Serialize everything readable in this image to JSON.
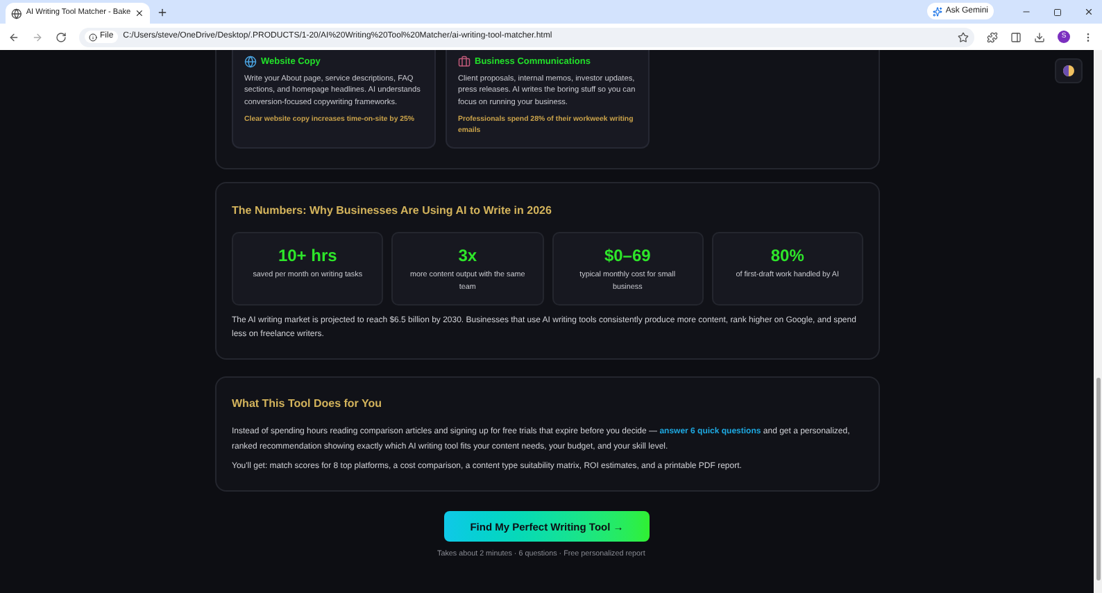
{
  "browser": {
    "tab_title": "AI Writing Tool Matcher - Bake",
    "file_chip": "File",
    "url": "C:/Users/steve/OneDrive/Desktop/.PRODUCTS/1-20/AI%20Writing%20Tool%20Matcher/ai-writing-tool-matcher.html",
    "gemini": "Ask Gemini",
    "avatar": "S"
  },
  "use_cases": [
    {
      "kind": "globe",
      "title": "Website Copy",
      "text": "Write your About page, service descriptions, FAQ sections, and homepage headlines. AI understands conversion-focused copywriting frameworks.",
      "stat": "Clear website copy increases time-on-site by 25%"
    },
    {
      "kind": "briefcase",
      "title": "Business Communications",
      "text": "Client proposals, internal memos, investor updates, press releases. AI writes the boring stuff so you can focus on running your business.",
      "stat": "Professionals spend 28% of their workweek writing emails"
    }
  ],
  "numbers": {
    "title": "The Numbers: Why Businesses Are Using AI to Write in 2026",
    "stats": [
      {
        "value": "10+ hrs",
        "label": "saved per month on writing tasks"
      },
      {
        "value": "3x",
        "label": "more content output with the same team"
      },
      {
        "value": "$0–69",
        "label": "typical monthly cost for small business"
      },
      {
        "value": "80%",
        "label": "of first-draft work handled by AI"
      }
    ],
    "paragraph": "The AI writing market is projected to reach $6.5 billion by 2030. Businesses that use AI writing tools consistently produce more content, rank higher on Google, and spend less on freelance writers."
  },
  "about": {
    "title": "What This Tool Does for You",
    "paragraph_before": "Instead of spending hours reading comparison articles and signing up for free trials that expire before you decide —",
    "link": "answer 6 quick questions",
    "paragraph_after": "and get a personalized, ranked recommendation showing exactly which AI writing tool fits your content needs, your budget, and your skill level.",
    "deliverables": "You'll get: match scores for 8 top platforms, a cost comparison, a content type suitability matrix, ROI estimates, and a printable PDF report."
  },
  "cta": {
    "button": "Find My Perfect Writing Tool →",
    "caption": "Takes about 2 minutes · 6 questions · Free personalized report"
  }
}
